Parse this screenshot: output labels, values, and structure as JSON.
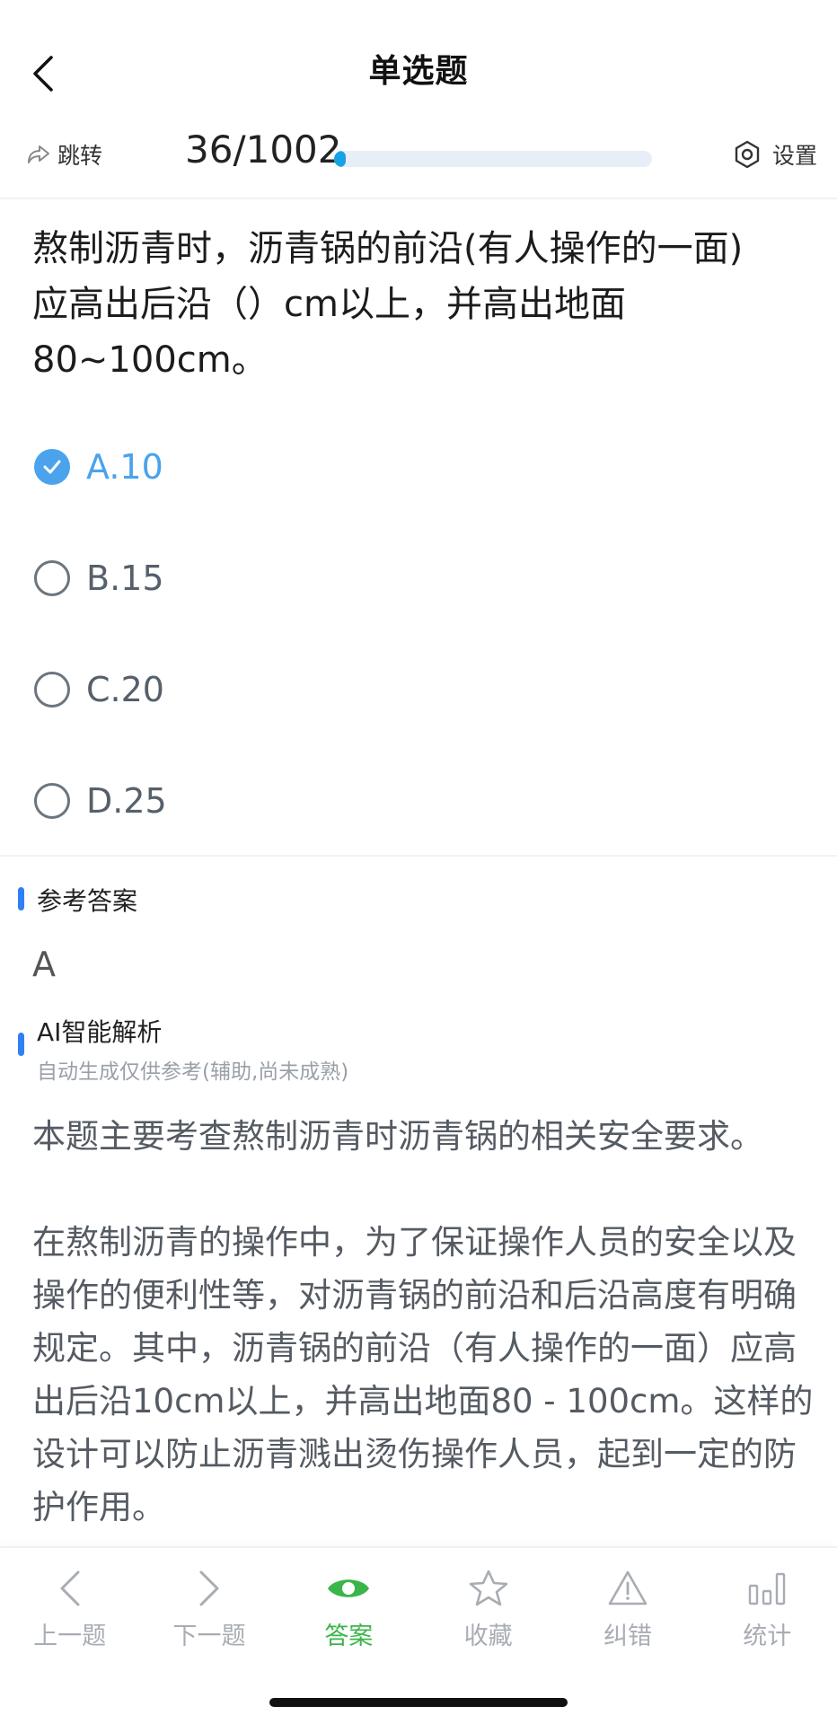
{
  "header": {
    "title": "单选题",
    "back_icon": "chevron-left-icon"
  },
  "progress": {
    "jump_label": "跳转",
    "counter": "36/1002",
    "current": 36,
    "total": 1002,
    "fraction": 0.036,
    "settings_label": "设置"
  },
  "question": {
    "text_line1": "熬制沥青时，沥青锅的前沿(有人操作的一面)",
    "text_line2": "应高出后沿（）cm以上，并高出地面",
    "text_line3": "80~100cm。"
  },
  "options": [
    {
      "label": "A.10",
      "selected": true
    },
    {
      "label": "B.15",
      "selected": false
    },
    {
      "label": "C.20",
      "selected": false
    },
    {
      "label": "D.25",
      "selected": false
    }
  ],
  "reference": {
    "title": "参考答案",
    "answer": "A"
  },
  "ai": {
    "title": "AI智能解析",
    "subtitle": "自动生成仅供参考(辅助,尚未成熟)",
    "para1": "本题主要考查熬制沥青时沥青锅的相关安全要求。",
    "para2": "在熬制沥青的操作中，为了保证操作人员的安全以及操作的便利性等，对沥青锅的前沿和后沿高度有明确规定。其中，沥青锅的前沿（有人操作的一面）应高出后沿10cm以上，并高出地面80 - 100cm。这样的设计可以防止沥青溅出烫伤操作人员，起到一定的防护作用。"
  },
  "tabs": [
    {
      "label": "上一题",
      "icon": "chevron-left-icon"
    },
    {
      "label": "下一题",
      "icon": "chevron-right-icon"
    },
    {
      "label": "答案",
      "icon": "eye-icon"
    },
    {
      "label": "收藏",
      "icon": "star-icon"
    },
    {
      "label": "纠错",
      "icon": "warning-icon"
    },
    {
      "label": "统计",
      "icon": "bar-chart-icon"
    }
  ],
  "colors": {
    "accent_blue": "#4aa3ec",
    "progress_blue": "#17a2e6",
    "active_green": "#3bb54a",
    "section_bar": "#2f7ff5"
  }
}
